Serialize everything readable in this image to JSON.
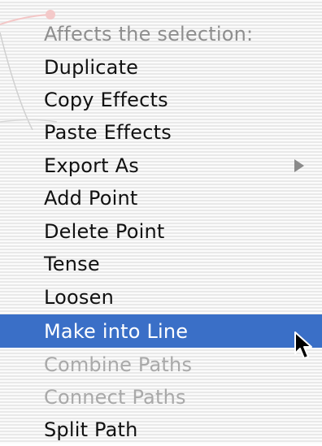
{
  "menu": {
    "header": "Affects the selection:",
    "items": [
      {
        "label": "Duplicate",
        "state": "enabled"
      },
      {
        "label": "Copy Effects",
        "state": "enabled"
      },
      {
        "label": "Paste Effects",
        "state": "enabled"
      },
      {
        "label": "Export As",
        "state": "enabled",
        "submenu": true
      },
      {
        "label": "Add Point",
        "state": "enabled"
      },
      {
        "label": "Delete Point",
        "state": "enabled"
      },
      {
        "label": "Tense",
        "state": "enabled"
      },
      {
        "label": "Loosen",
        "state": "enabled"
      },
      {
        "label": "Make into Line",
        "state": "selected"
      },
      {
        "label": "Combine Paths",
        "state": "disabled"
      },
      {
        "label": "Connect Paths",
        "state": "disabled"
      },
      {
        "label": "Split Path",
        "state": "enabled"
      }
    ]
  },
  "colors": {
    "highlight": "#3a6fc7",
    "text": "#111111",
    "disabled_text": "#a9a9a9",
    "header_text": "#8e8e8e"
  },
  "icons": {
    "submenu": "triangle-right-icon",
    "pointer": "arrow-cursor-icon"
  }
}
